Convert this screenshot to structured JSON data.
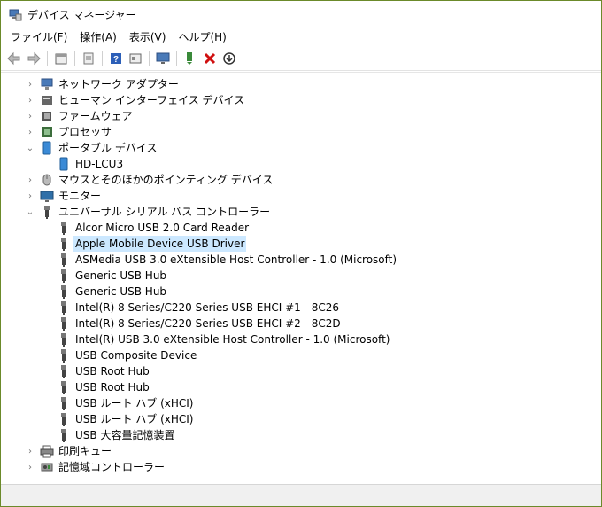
{
  "window": {
    "title": "デバイス マネージャー"
  },
  "menu": [
    "ファイル(F)",
    "操作(A)",
    "表示(V)",
    "ヘルプ(H)"
  ],
  "toolbar": [
    "back-icon",
    "forward-icon",
    "properties-icon",
    "list-icon",
    "help-icon",
    "view-icon",
    "monitor-icon",
    "update-driver-icon",
    "uninstall-icon",
    "install-icon"
  ],
  "tree": {
    "network": "ネットワーク アダプター",
    "hid": "ヒューマン インターフェイス デバイス",
    "firmware": "ファームウェア",
    "processor": "プロセッサ",
    "portable": "ポータブル デバイス",
    "portable_child": "HD-LCU3",
    "mouse": "マウスとそのほかのポインティング デバイス",
    "monitor": "モニター",
    "usb": "ユニバーサル シリアル バス コントローラー",
    "usb_children": [
      "Alcor Micro USB 2.0 Card Reader",
      "Apple Mobile Device USB Driver",
      "ASMedia USB 3.0 eXtensible Host Controller - 1.0 (Microsoft)",
      "Generic USB Hub",
      "Generic USB Hub",
      "Intel(R) 8 Series/C220 Series USB EHCI #1 - 8C26",
      "Intel(R) 8 Series/C220 Series USB EHCI #2 - 8C2D",
      "Intel(R) USB 3.0 eXtensible Host Controller - 1.0 (Microsoft)",
      "USB Composite Device",
      "USB Root Hub",
      "USB Root Hub",
      "USB ルート ハブ (xHCI)",
      "USB ルート ハブ (xHCI)",
      "USB 大容量記憶装置"
    ],
    "print": "印刷キュー",
    "storage": "記憶域コントローラー"
  },
  "colors": {
    "selected_bg": "#cce8ff",
    "window_border": "#6b8a2a",
    "outer_bg": "#8a8a8a"
  }
}
